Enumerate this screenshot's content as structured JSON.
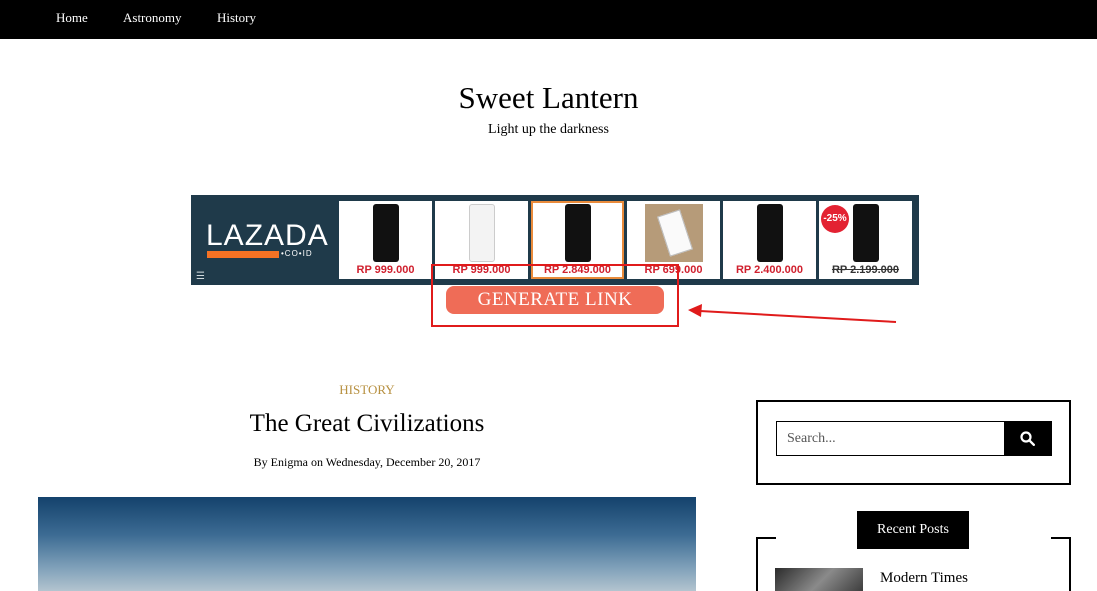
{
  "nav": {
    "items": [
      "Home",
      "Astronomy",
      "History"
    ]
  },
  "site": {
    "title": "Sweet Lantern",
    "tagline": "Light up the darkness"
  },
  "ad": {
    "logo": "LAZADA",
    "logo_sub": "•CO•ID",
    "menu_icon": "menu-icon",
    "products": [
      {
        "price": "RP 999.000",
        "image": "black-phone"
      },
      {
        "price": "RP 999.000",
        "image": "white-phone"
      },
      {
        "price": "RP 2.849.000",
        "image": "black-phone"
      },
      {
        "price": "RP 699.000",
        "image": "phone-photo"
      },
      {
        "price": "RP 2.400.000",
        "image": "black-phone"
      },
      {
        "price": "RP 2.199.000",
        "image": "black-phone",
        "badge": "-25%",
        "strikethrough": true
      }
    ],
    "generate_label": "GENERATE LINK",
    "annotation_color": "#e01b1b",
    "button_color": "#ef6c57"
  },
  "post": {
    "category": "HISTORY",
    "title": "The Great Civilizations",
    "byline": "By Enigma on Wednesday, December 20, 2017"
  },
  "sidebar": {
    "search_placeholder": "Search...",
    "search_icon": "search-icon",
    "recent_heading": "Recent Posts",
    "recent_items": [
      "Modern Times"
    ]
  }
}
